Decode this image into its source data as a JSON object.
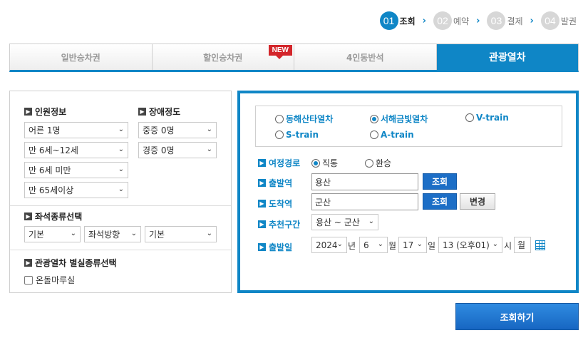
{
  "steps": [
    {
      "num": "01",
      "label": "조회",
      "active": true
    },
    {
      "num": "02",
      "label": "예약",
      "active": false
    },
    {
      "num": "03",
      "label": "결제",
      "active": false
    },
    {
      "num": "04",
      "label": "발권",
      "active": false
    }
  ],
  "tabs": [
    {
      "label": "일반승차권"
    },
    {
      "label": "할인승차권",
      "badge": "NEW"
    },
    {
      "label": "4인동반석"
    },
    {
      "label": "관광열차",
      "active": true
    }
  ],
  "left": {
    "passenger_title": "인원정보",
    "disability_title": "장애정도",
    "passengers": [
      "어른 1명",
      "만 6세~12세",
      "만 6세 미만",
      "만 65세이상"
    ],
    "disability": [
      "중증 0명",
      "경증 0명"
    ],
    "seat_title": "좌석종류선택",
    "seat_selects": [
      "기본",
      "좌석방향",
      "기본"
    ],
    "room_title": "관광열차 별실종류선택",
    "room_option": "온돌마루실"
  },
  "right": {
    "trains": [
      {
        "label": "동해산타열차",
        "checked": false
      },
      {
        "label": "서해금빛열차",
        "checked": true
      },
      {
        "label": "V-train",
        "checked": false
      },
      {
        "label": "S-train",
        "checked": false
      },
      {
        "label": "A-train",
        "checked": false
      }
    ],
    "route_label": "여정경로",
    "route_options": [
      {
        "label": "직통",
        "checked": true
      },
      {
        "label": "환승",
        "checked": false
      }
    ],
    "departure_label": "출발역",
    "departure_value": "용산",
    "arrival_label": "도착역",
    "arrival_value": "군산",
    "lookup_btn": "조회",
    "change_btn": "변경",
    "recommend_label": "추천구간",
    "recommend_value": "용산 ~ 군산",
    "date_label": "출발일",
    "year": "2024",
    "year_unit": "년",
    "month": "6",
    "month_unit": "월",
    "day": "17",
    "day_unit": "일",
    "hour": "13 (오후01)",
    "hour_unit": "시",
    "weekday": "월"
  },
  "search_button": "조회하기",
  "colors": {
    "accent": "#0f86c6",
    "button": "#1c6ec6",
    "badge": "#d3262b"
  }
}
